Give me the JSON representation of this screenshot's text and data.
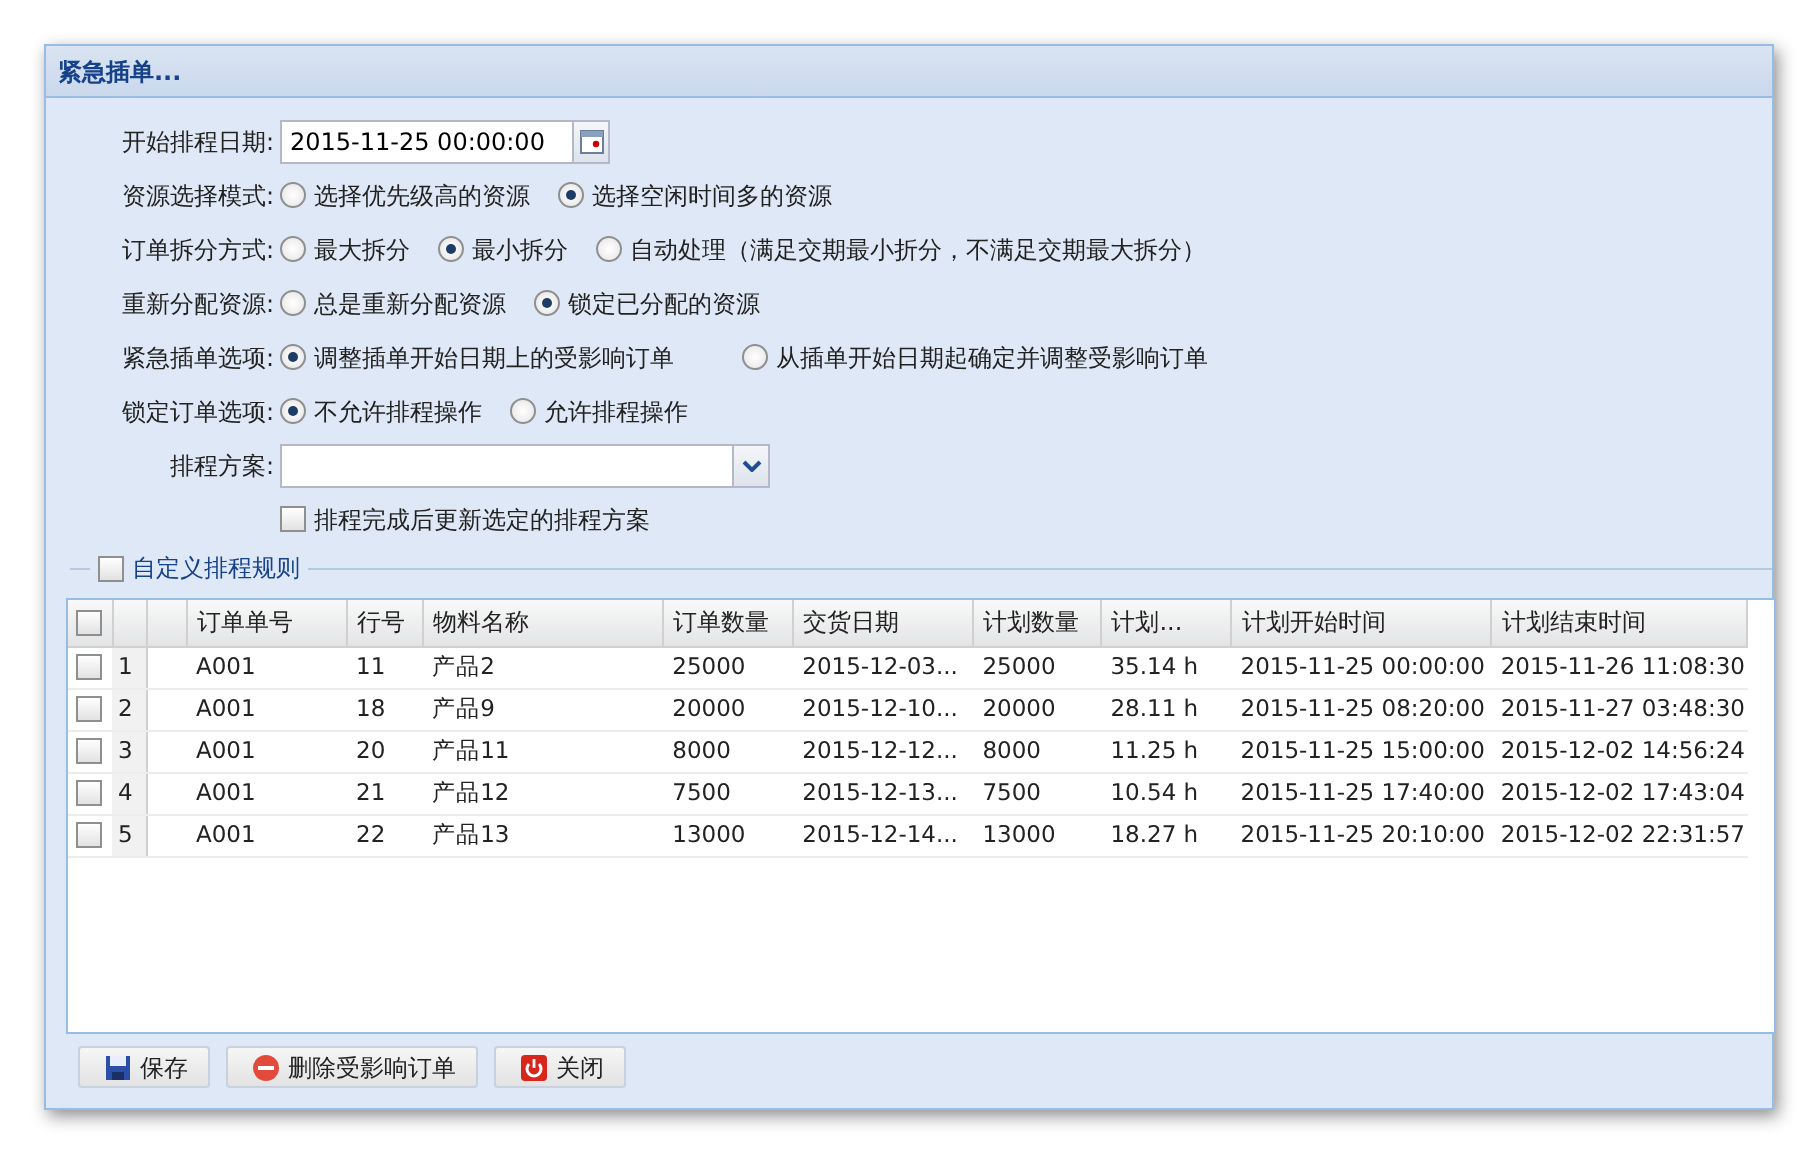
{
  "window": {
    "title": "紧急插单..."
  },
  "form": [
    {
      "kind": "date",
      "label": "开始排程日期:",
      "value": "2015-11-25 00:00:00"
    },
    {
      "kind": "radio",
      "label": "资源选择模式:",
      "options": [
        {
          "label": "选择优先级高的资源",
          "selected": false
        },
        {
          "label": "选择空闲时间多的资源",
          "selected": true
        }
      ]
    },
    {
      "kind": "radio",
      "label": "订单拆分方式:",
      "options": [
        {
          "label": "最大拆分",
          "selected": false
        },
        {
          "label": "最小拆分",
          "selected": true
        },
        {
          "label": "自动处理（满足交期最小折分，不满足交期最大拆分）",
          "selected": false
        }
      ]
    },
    {
      "kind": "radio",
      "label": "重新分配资源:",
      "options": [
        {
          "label": "总是重新分配资源",
          "selected": false
        },
        {
          "label": "锁定已分配的资源",
          "selected": true
        }
      ]
    },
    {
      "kind": "radio",
      "label": "紧急插单选项:",
      "options": [
        {
          "label": "调整插单开始日期上的受影响订单",
          "selected": true
        },
        {
          "label": "从插单开始日期起确定并调整受影响订单",
          "selected": false
        }
      ]
    },
    {
      "kind": "radio",
      "label": "锁定订单选项:",
      "options": [
        {
          "label": "不允许排程操作",
          "selected": true
        },
        {
          "label": "允许排程操作",
          "selected": false
        }
      ]
    },
    {
      "kind": "select",
      "label": "排程方案:"
    },
    {
      "kind": "checkbox",
      "label": "排程完成后更新选定的排程方案",
      "checked": false
    }
  ],
  "fieldset": {
    "label": "自定义排程规则",
    "checked": false
  },
  "grid": {
    "all_checked": false,
    "columns": [
      "订单单号",
      "行号",
      "物料名称",
      "订单数量",
      "交货日期",
      "计划数量",
      "计划...",
      "计划开始时间",
      "计划结束时间"
    ],
    "rows": [
      {
        "checked": false,
        "number": "1",
        "cells": [
          "A001",
          "11",
          "产品2",
          "25000",
          "2015-12-03...",
          "25000",
          "35.14 h",
          "2015-11-25 00:00:00",
          "2015-11-26 11:08:30"
        ]
      },
      {
        "checked": false,
        "number": "2",
        "cells": [
          "A001",
          "18",
          "产品9",
          "20000",
          "2015-12-10...",
          "20000",
          "28.11 h",
          "2015-11-25 08:20:00",
          "2015-11-27 03:48:30"
        ]
      },
      {
        "checked": false,
        "number": "3",
        "cells": [
          "A001",
          "20",
          "产品11",
          "8000",
          "2015-12-12...",
          "8000",
          "11.25 h",
          "2015-11-25 15:00:00",
          "2015-12-02 14:56:24"
        ]
      },
      {
        "checked": false,
        "number": "4",
        "cells": [
          "A001",
          "21",
          "产品12",
          "7500",
          "2015-12-13...",
          "7500",
          "10.54 h",
          "2015-11-25 17:40:00",
          "2015-12-02 17:43:04"
        ]
      },
      {
        "checked": false,
        "number": "5",
        "cells": [
          "A001",
          "22",
          "产品13",
          "13000",
          "2015-12-14...",
          "13000",
          "18.27 h",
          "2015-11-25 20:10:00",
          "2015-12-02 22:31:57"
        ]
      }
    ]
  },
  "buttons": [
    {
      "kind": "save",
      "label": "保存"
    },
    {
      "kind": "delete",
      "label": "删除受影响订单"
    },
    {
      "kind": "close",
      "label": "关闭"
    }
  ]
}
